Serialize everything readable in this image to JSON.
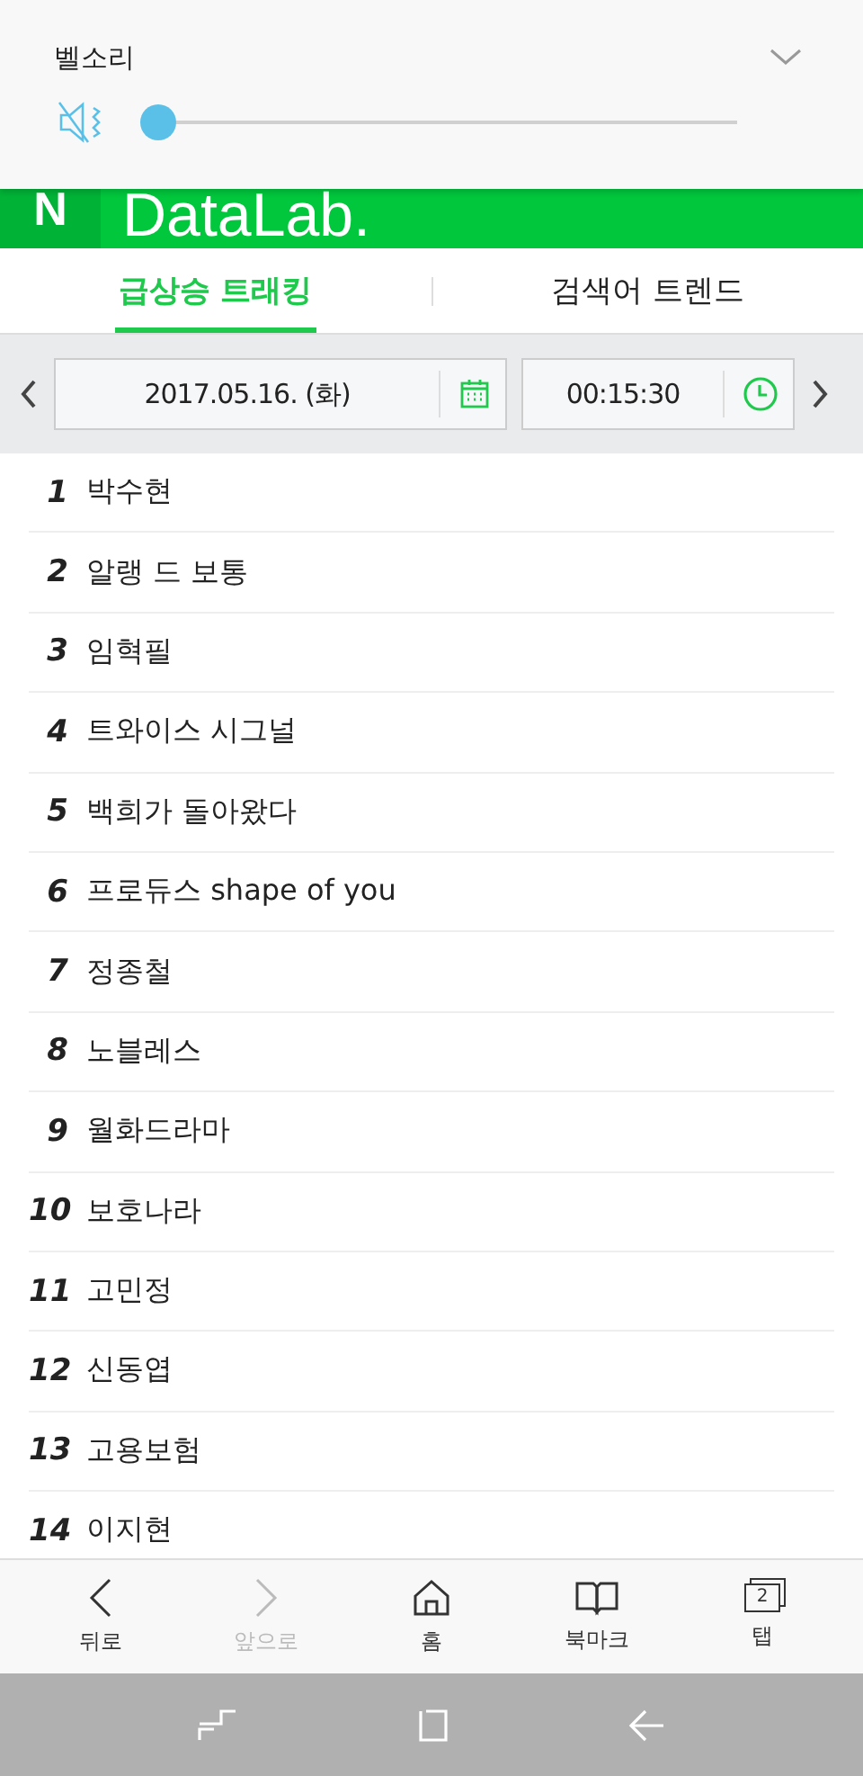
{
  "volume_panel": {
    "title": "벨소리",
    "level": 0.0
  },
  "header": {
    "logo": "N",
    "title": "DataLab."
  },
  "tabs": [
    {
      "label": "급상승 트래킹",
      "selected": true
    },
    {
      "label": "검색어 트렌드",
      "selected": false
    }
  ],
  "date_bar": {
    "date": "2017.05.16. (화)",
    "time": "00:15:30"
  },
  "rankings": [
    {
      "rank": "1",
      "keyword": "박수현"
    },
    {
      "rank": "2",
      "keyword": "알랭 드 보통"
    },
    {
      "rank": "3",
      "keyword": "임혁필"
    },
    {
      "rank": "4",
      "keyword": "트와이스 시그널"
    },
    {
      "rank": "5",
      "keyword": "백희가 돌아왔다"
    },
    {
      "rank": "6",
      "keyword": "프로듀스 shape of you"
    },
    {
      "rank": "7",
      "keyword": "정종철"
    },
    {
      "rank": "8",
      "keyword": "노블레스"
    },
    {
      "rank": "9",
      "keyword": "월화드라마"
    },
    {
      "rank": "10",
      "keyword": "보호나라"
    },
    {
      "rank": "11",
      "keyword": "고민정"
    },
    {
      "rank": "12",
      "keyword": "신동엽"
    },
    {
      "rank": "13",
      "keyword": "고용보험"
    },
    {
      "rank": "14",
      "keyword": "이지현"
    }
  ],
  "toolbar": [
    {
      "kind": "back",
      "label": "뒤로",
      "disabled": false
    },
    {
      "kind": "forward",
      "label": "앞으로",
      "disabled": true
    },
    {
      "kind": "home",
      "label": "홈",
      "disabled": false
    },
    {
      "kind": "bookmark",
      "label": "북마크",
      "disabled": false
    },
    {
      "kind": "tabs",
      "label": "탭",
      "disabled": false,
      "count": "2"
    }
  ]
}
